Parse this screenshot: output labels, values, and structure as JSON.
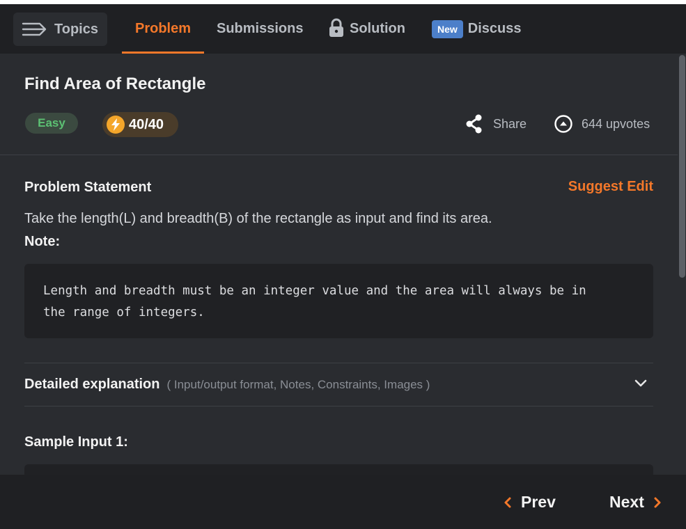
{
  "tabs": {
    "topics": "Topics",
    "problem": "Problem",
    "submissions": "Submissions",
    "solution": "Solution",
    "discuss_badge": "New",
    "discuss": "Discuss",
    "active": "Problem"
  },
  "problem": {
    "title": "Find Area of Rectangle",
    "difficulty": "Easy",
    "score": "40/40",
    "share_label": "Share",
    "upvotes_label": "644 upvotes"
  },
  "statement": {
    "heading": "Problem Statement",
    "suggest_edit": "Suggest Edit",
    "text": "Take the length(L) and breadth(B) of the rectangle as input and find its area.",
    "note_label": "Note:",
    "note_lines": [
      "Length and breadth must be an integer value and the area will always be in",
      "the range of integers."
    ]
  },
  "explanation": {
    "title": "Detailed explanation",
    "subtitle": "( Input/output format, Notes, Constraints, Images )"
  },
  "sample": {
    "title": "Sample Input 1:"
  },
  "footer": {
    "prev": "Prev",
    "next": "Next"
  },
  "colors": {
    "accent": "#f4782a",
    "easy": "#5cc073",
    "badge_new": "#4c7fc9",
    "background": "#2a2c30",
    "bar": "#1f2023"
  },
  "icons": {
    "topics": "menu-arrow-icon",
    "solution": "lock-icon",
    "score": "lightning-bolt-icon",
    "share": "share-icon",
    "upvote": "upvote-circle-icon",
    "expand": "chevron-down-icon",
    "prev": "chevron-left-icon",
    "next": "chevron-right-icon"
  }
}
